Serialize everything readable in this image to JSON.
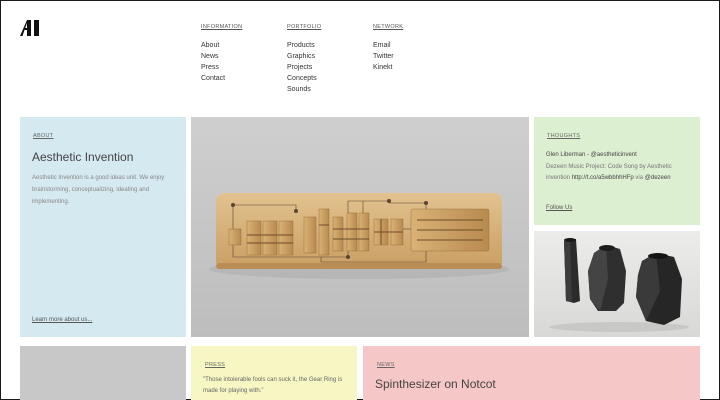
{
  "brand": {
    "logo_text": "AI"
  },
  "nav": [
    {
      "heading": "INFORMATION",
      "items": [
        "About",
        "News",
        "Press",
        "Contact"
      ]
    },
    {
      "heading": "PORTFOLIO",
      "items": [
        "Products",
        "Graphics",
        "Projects",
        "Concepts",
        "Sounds"
      ]
    },
    {
      "heading": "NETWORK",
      "items": [
        "Email",
        "Twitter",
        "Kinekt"
      ]
    }
  ],
  "about": {
    "label": "ABOUT",
    "title": "Aesthetic Invention",
    "description": "Aesthetic Invention is a good ideas unit. We enjoy brainstorming, conceptualizing, ideating and implementing.",
    "more_link": "Learn more about us..."
  },
  "thoughts": {
    "label": "THOUGHTS",
    "author": "Glen Liberman - @aestheticinvent",
    "tweet_text": "Dezeen Music Project: Code Song by Aesthetic invention",
    "tweet_link": "http://t.co/a5wbbhhHFp",
    "tweet_via": "via",
    "tweet_mention": "@dezeen",
    "follow_link": "Follow Us"
  },
  "press": {
    "label": "PRESS",
    "quote": "\"Those intolerable fools can suck it, the Gear Ring is made for playing with.\""
  },
  "news": {
    "label": "NEWS",
    "headline": "Spinthesizer on Notcot"
  },
  "colors": {
    "about_bg": "#d5e9f1",
    "thoughts_bg": "#dcefd1",
    "press_bg": "#f6f7c3",
    "news_bg": "#f5c7c7",
    "hero_bg": "#c4c4c4"
  }
}
